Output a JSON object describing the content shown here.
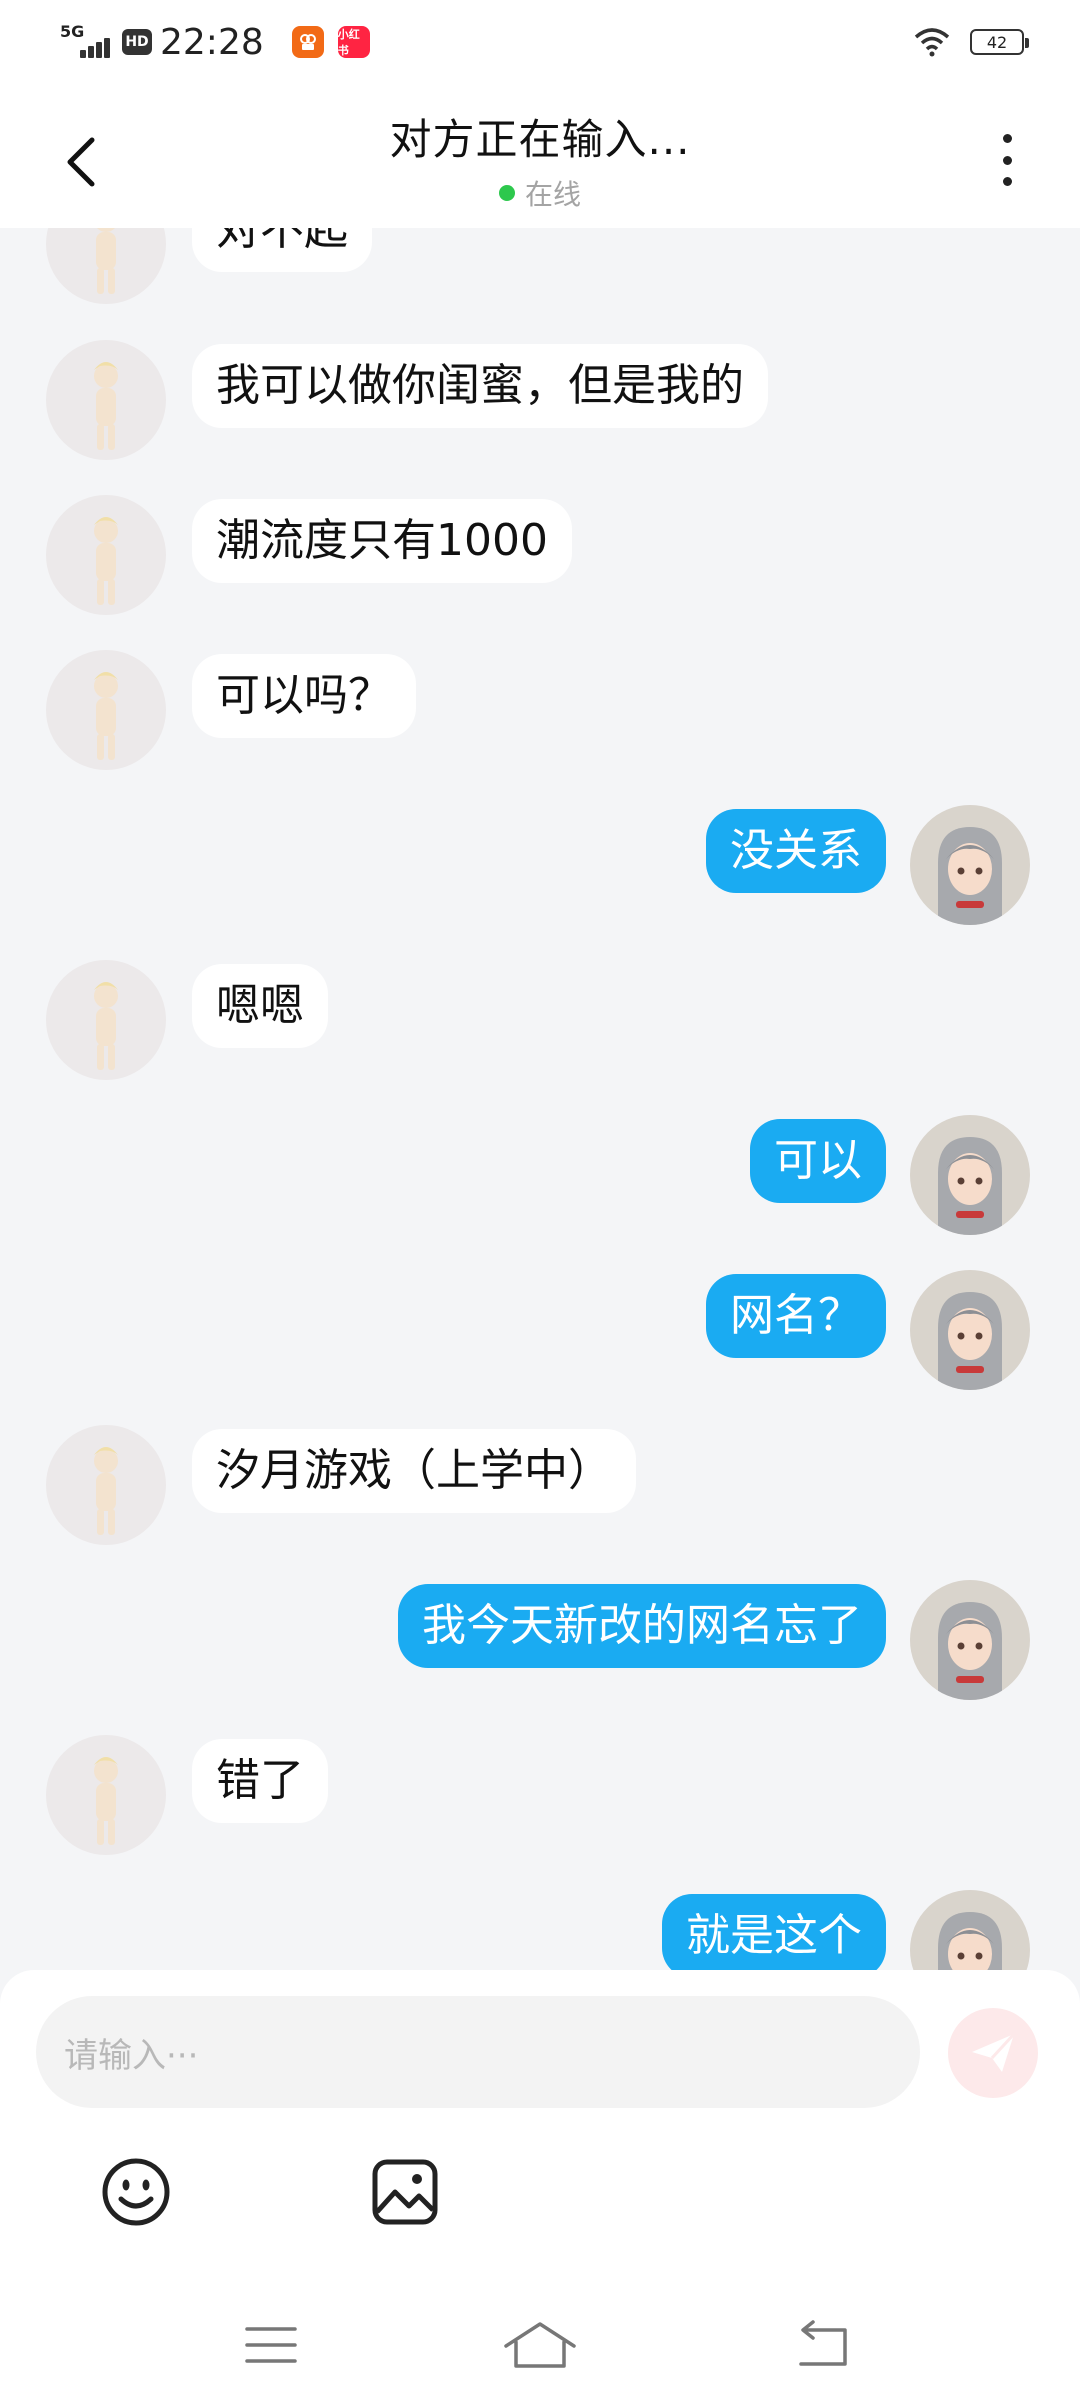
{
  "status_bar": {
    "network": "5G",
    "hd": "HD",
    "time": "22:28",
    "app_icons": [
      {
        "name": "orange-app-icon",
        "color": "#f26a16"
      },
      {
        "name": "red-app-icon",
        "label": "小红书",
        "color": "#ff2442"
      }
    ],
    "battery": "42"
  },
  "header": {
    "title": "对方正在输入...",
    "status": "在线",
    "status_color": "#2dc84d"
  },
  "messages": [
    {
      "side": "left",
      "text": "对不起"
    },
    {
      "side": "left",
      "text": "我可以做你闺蜜，但是我的"
    },
    {
      "side": "left",
      "text": "潮流度只有1000"
    },
    {
      "side": "left",
      "text": "可以吗？"
    },
    {
      "side": "right",
      "text": "没关系"
    },
    {
      "side": "left",
      "text": "嗯嗯"
    },
    {
      "side": "right",
      "text": "可以"
    },
    {
      "side": "right",
      "text": "网名？"
    },
    {
      "side": "left",
      "text": "汐月游戏（上学中）"
    },
    {
      "side": "right",
      "text": "我今天新改的网名忘了"
    },
    {
      "side": "left",
      "text": "错了"
    },
    {
      "side": "right",
      "text": "就是这个"
    }
  ],
  "colors": {
    "self_bubble": "#1aabf2",
    "other_bubble": "#ffffff",
    "background": "#f4f5f7",
    "send_button": "#fde9ea"
  },
  "input": {
    "placeholder": "请输入···"
  },
  "toolbar": {
    "icons": [
      "emoji-icon",
      "image-icon"
    ]
  },
  "navigation": {
    "icons": [
      "menu-icon",
      "home-icon",
      "back-icon"
    ]
  }
}
